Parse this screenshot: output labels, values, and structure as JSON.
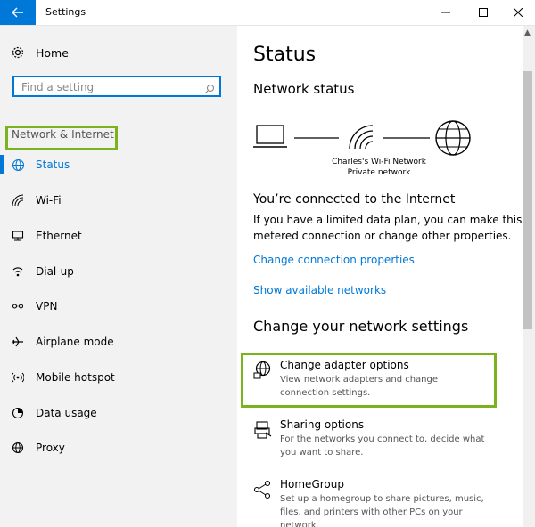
{
  "window": {
    "title": "Settings"
  },
  "sidebar": {
    "home_label": "Home",
    "search_placeholder": "Find a setting",
    "section_title": "Network & Internet",
    "items": [
      {
        "label": "Status",
        "icon": "globe-icon",
        "active": true
      },
      {
        "label": "Wi-Fi",
        "icon": "wifi-icon"
      },
      {
        "label": "Ethernet",
        "icon": "ethernet-icon"
      },
      {
        "label": "Dial-up",
        "icon": "dial-up-icon"
      },
      {
        "label": "VPN",
        "icon": "vpn-icon"
      },
      {
        "label": "Airplane mode",
        "icon": "airplane-icon"
      },
      {
        "label": "Mobile hotspot",
        "icon": "hotspot-icon"
      },
      {
        "label": "Data usage",
        "icon": "data-usage-icon"
      },
      {
        "label": "Proxy",
        "icon": "proxy-icon"
      }
    ]
  },
  "main": {
    "title": "Status",
    "network_status_heading": "Network status",
    "network_name": "Charles's Wi-Fi Network",
    "network_type": "Private network",
    "connected_heading": "You’re connected to the Internet",
    "connected_desc_line1": "If you have a limited data plan, you can make this netw",
    "connected_desc_line2": "metered connection or change other properties.",
    "link_change_properties": "Change connection properties",
    "link_show_networks": "Show available networks",
    "change_settings_heading": "Change your network settings",
    "options": [
      {
        "title": "Change adapter options",
        "desc": "View network adapters and change connection settings.",
        "icon": "adapter-icon"
      },
      {
        "title": "Sharing options",
        "desc": "For the networks you connect to, decide what you want to share.",
        "icon": "sharing-icon"
      },
      {
        "title": "HomeGroup",
        "desc": "Set up a homegroup to share pictures, music, files, and printers with other PCs on your network.",
        "icon": "homegroup-icon"
      }
    ]
  },
  "colors": {
    "accent": "#0078d7",
    "highlight": "#7ab31e"
  }
}
